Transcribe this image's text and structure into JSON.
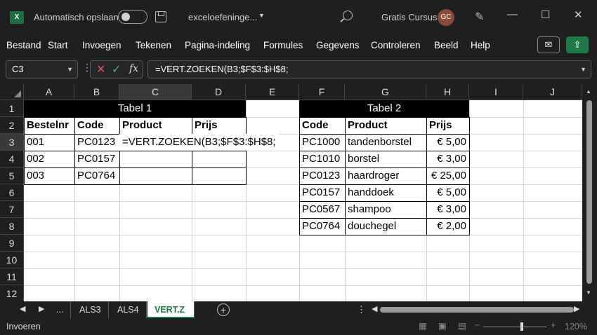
{
  "titlebar": {
    "app_logo": "X",
    "autosave_label": "Automatisch opslaan",
    "autosave_on": false,
    "filename": "exceloefeninge...",
    "user_name": "Gratis Cursus",
    "avatar_initials": "GC",
    "minimize": "—",
    "restore": "☐",
    "close": "✕",
    "avatar_color": "#8b4a3c"
  },
  "ribbon": {
    "tabs": [
      "Bestand",
      "Start",
      "Invoegen",
      "Tekenen",
      "Pagina-indeling",
      "Formules",
      "Gegevens",
      "Controleren",
      "Beeld",
      "Help"
    ],
    "comment_icon": "✉",
    "share_icon": "⇪",
    "share_color": "#1d7a45"
  },
  "formulabar": {
    "namebox": "C3",
    "cancel": "✕",
    "enter": "✓",
    "fx": "fx",
    "formula": "=VERT.ZOEKEN(B3;$F$3:$H$8;"
  },
  "columns": [
    "A",
    "B",
    "C",
    "D",
    "E",
    "F",
    "G",
    "H",
    "I",
    "J"
  ],
  "rows": [
    "1",
    "2",
    "3",
    "4",
    "5",
    "6",
    "7",
    "8",
    "9",
    "10",
    "11",
    "12"
  ],
  "table1": {
    "title": "Tabel 1",
    "headers": [
      "Bestelnr",
      "Code",
      "Product",
      "Prijs"
    ],
    "rows": [
      [
        "001",
        "PC0123",
        "=VERT.ZOEKEN(B3;$F$3:$H$8;",
        ""
      ],
      [
        "002",
        "PC0157",
        "",
        ""
      ],
      [
        "003",
        "PC0764",
        "",
        ""
      ]
    ]
  },
  "table2": {
    "title": "Tabel 2",
    "headers": [
      "Code",
      "Product",
      "Prijs"
    ],
    "rows": [
      [
        "PC1000",
        "tandenborstel",
        "€ 5,00"
      ],
      [
        "PC1010",
        "borstel",
        "€ 3,00"
      ],
      [
        "PC0123",
        "haardroger",
        "€ 25,00"
      ],
      [
        "PC0157",
        "handdoek",
        "€ 5,00"
      ],
      [
        "PC0567",
        "shampoo",
        "€ 3,00"
      ],
      [
        "PC0764",
        "douchegel",
        "€ 2,00"
      ]
    ]
  },
  "sheets": {
    "ellipsis": "...",
    "tabs": [
      "ALS3",
      "ALS4",
      "VERT.Z"
    ],
    "active": "VERT.Z",
    "add": "+"
  },
  "status": {
    "mode": "Invoeren",
    "zoom": "120%",
    "zoom_out": "−",
    "zoom_in": "+"
  }
}
